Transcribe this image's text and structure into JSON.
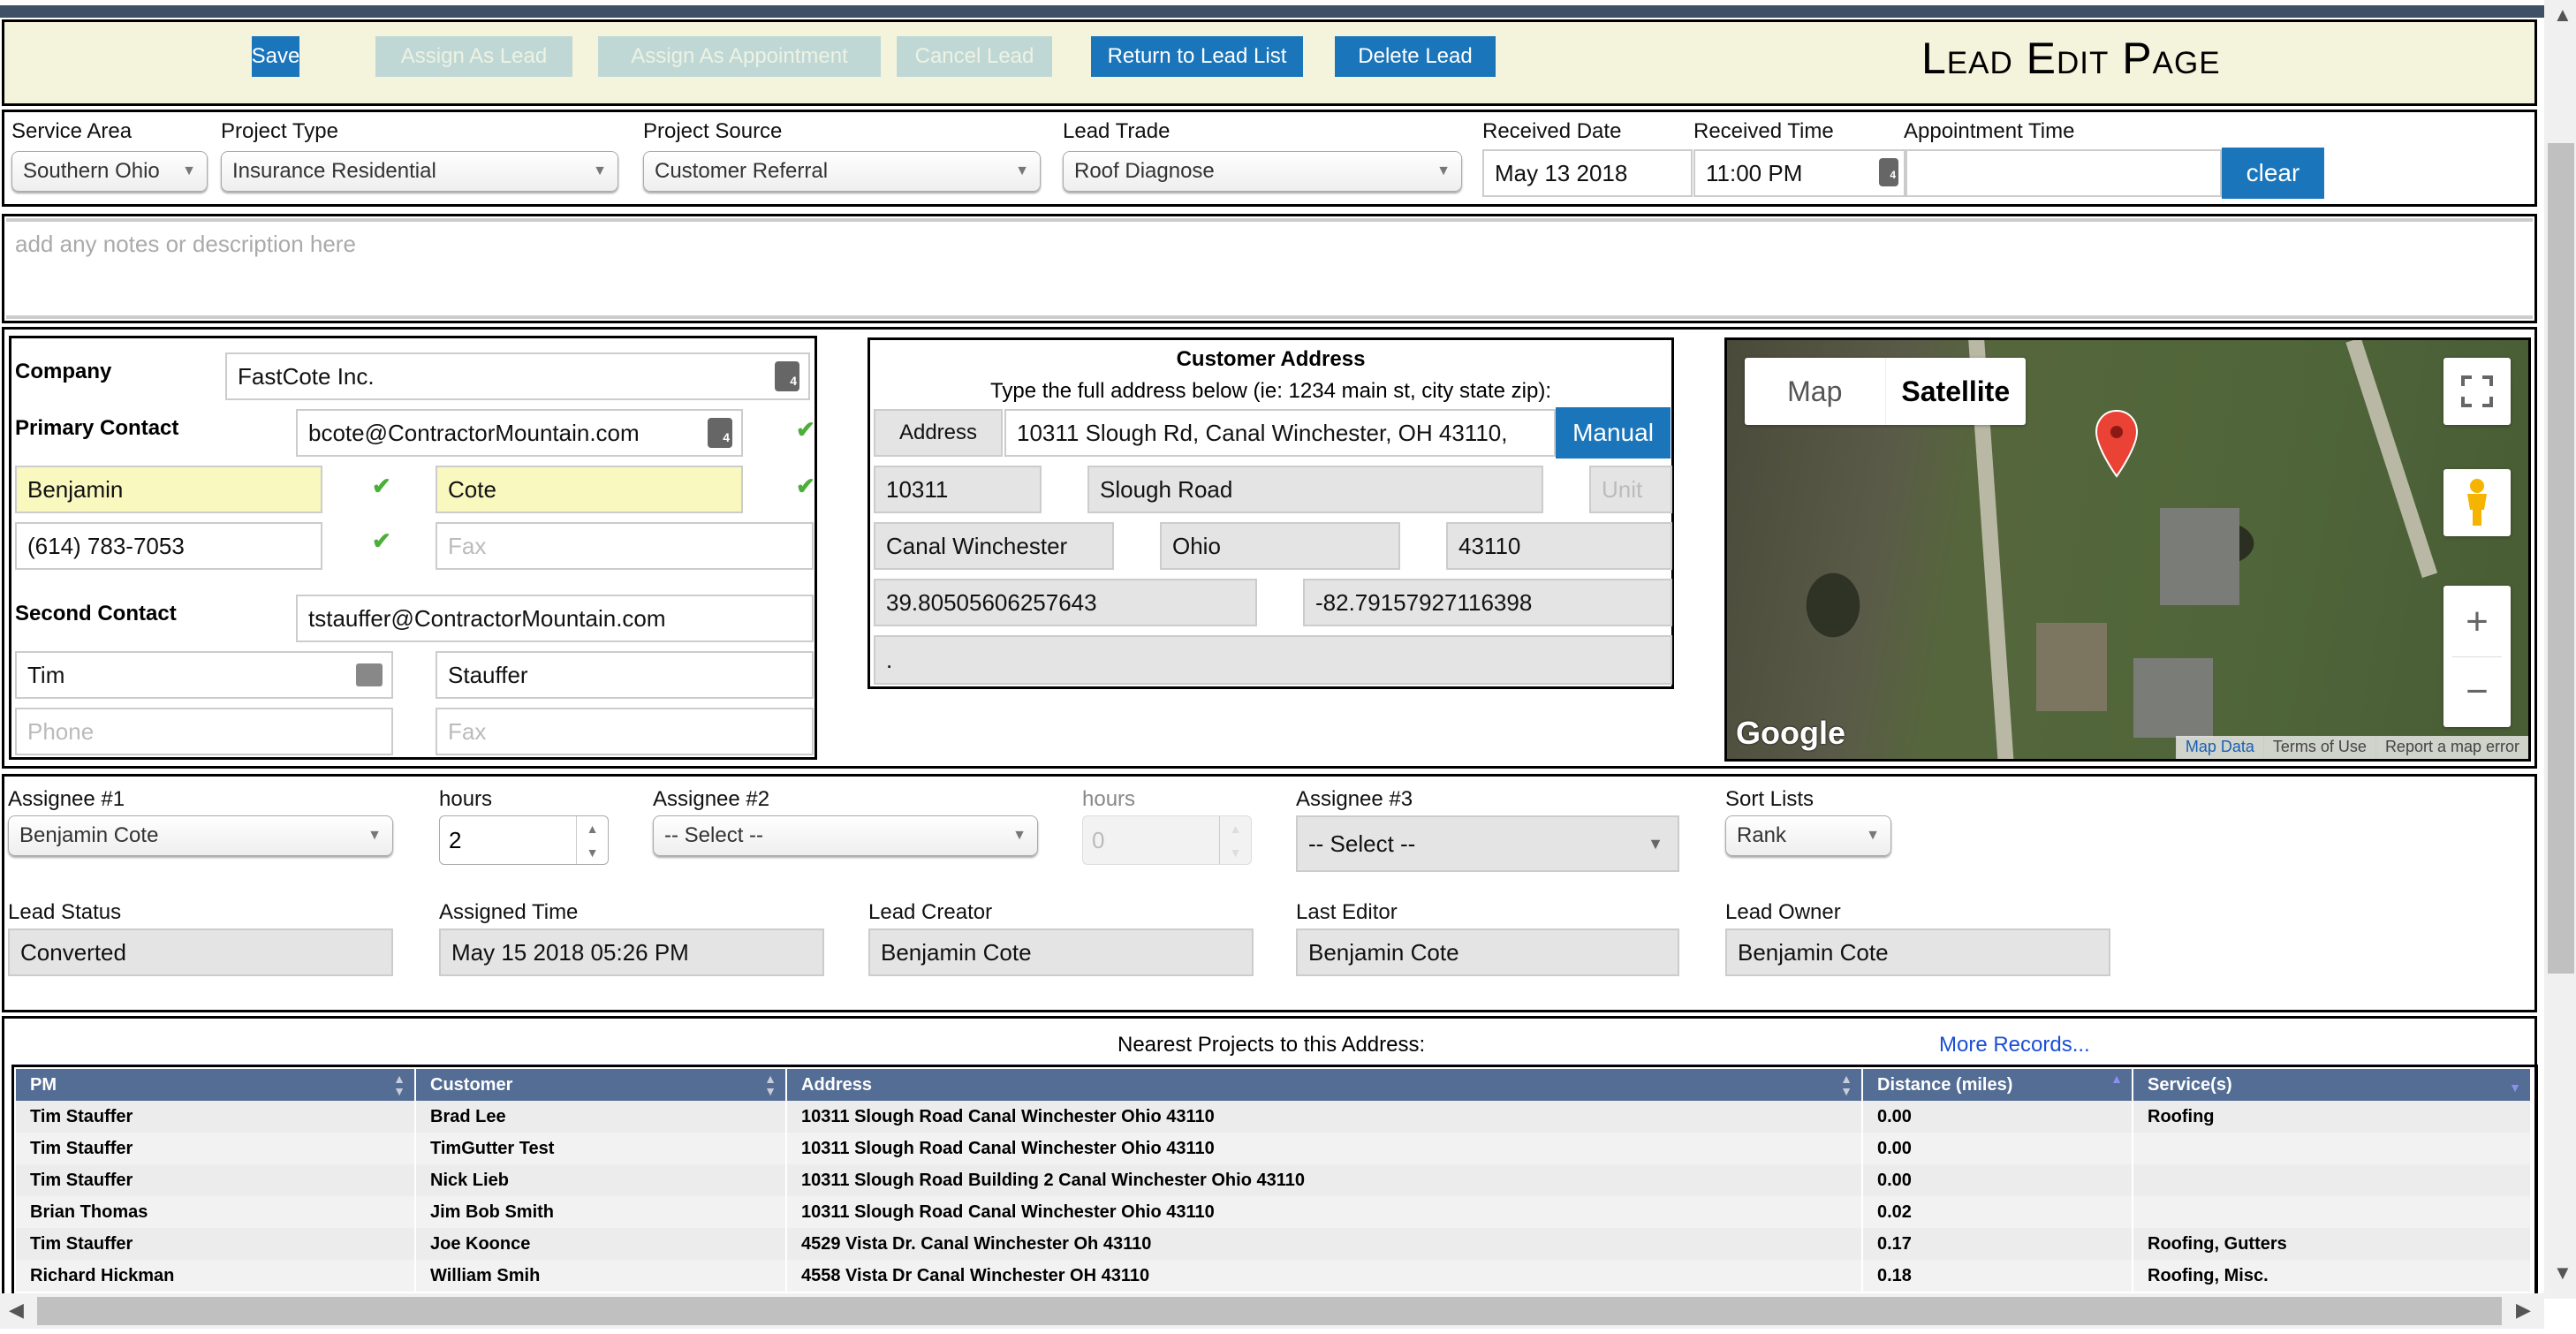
{
  "header": {
    "title": "Lead Edit Page",
    "buttons": {
      "save": "Save",
      "assign_lead": "Assign As Lead",
      "assign_appointment": "Assign As Appointment",
      "cancel_lead": "Cancel Lead",
      "return_list": "Return to Lead List",
      "delete_lead": "Delete Lead"
    }
  },
  "row1": {
    "service_area": {
      "label": "Service Area",
      "value": "Southern Ohio"
    },
    "project_type": {
      "label": "Project Type",
      "value": "Insurance Residential"
    },
    "project_source": {
      "label": "Project Source",
      "value": "Customer Referral"
    },
    "lead_trade": {
      "label": "Lead Trade",
      "value": "Roof Diagnose"
    },
    "received_date": {
      "label": "Received Date",
      "value": "May 13 2018"
    },
    "received_time": {
      "label": "Received Time",
      "value": "11:00 PM"
    },
    "appointment_time": {
      "label": "Appointment Time",
      "value": ""
    },
    "clear": "clear"
  },
  "notes": {
    "placeholder": "add any notes or description here"
  },
  "contact": {
    "company_label": "Company",
    "company": "FastCote Inc.",
    "primary_label": "Primary Contact",
    "primary_email": "bcote@ContractorMountain.com",
    "primary_first": "Benjamin",
    "primary_last": "Cote",
    "primary_phone": "(614) 783-7053",
    "primary_fax_placeholder": "Fax",
    "second_label": "Second Contact",
    "second_email": "tstauffer@ContractorMountain.com",
    "second_first": "Tim",
    "second_last": "Stauffer",
    "second_phone_placeholder": "Phone",
    "second_fax_placeholder": "Fax",
    "check": "✔",
    "badge": "4"
  },
  "address": {
    "title": "Customer Address",
    "subtitle": "Type the full address below (ie: 1234 main st, city state zip):",
    "address_label": "Address",
    "full": "10311 Slough Rd, Canal Winchester, OH 43110,",
    "manual": "Manual",
    "number": "10311",
    "street": "Slough Road",
    "unit_placeholder": "Unit",
    "city": "Canal Winchester",
    "state": "Ohio",
    "zip": "43110",
    "lat": "39.80505606257643",
    "lng": "-82.79157927116398",
    "extra": "."
  },
  "map": {
    "type_map": "Map",
    "type_satellite": "Satellite",
    "zoom_in": "+",
    "zoom_out": "−",
    "google": "Google",
    "footer": [
      "Map Data",
      "Terms of Use",
      "Report a map error"
    ]
  },
  "assign": {
    "assignee1": {
      "label": "Assignee #1",
      "value": "Benjamin Cote"
    },
    "hours1": {
      "label": "hours",
      "value": "2"
    },
    "assignee2": {
      "label": "Assignee #2",
      "value": "-- Select --"
    },
    "hours2": {
      "label": "hours",
      "value": "0"
    },
    "assignee3": {
      "label": "Assignee #3",
      "value": "-- Select --"
    },
    "sort": {
      "label": "Sort Lists",
      "value": "Rank"
    },
    "lead_status": {
      "label": "Lead Status",
      "value": "Converted"
    },
    "assigned_time": {
      "label": "Assigned Time",
      "value": "May 15 2018 05:26 PM"
    },
    "lead_creator": {
      "label": "Lead Creator",
      "value": "Benjamin Cote"
    },
    "last_editor": {
      "label": "Last Editor",
      "value": "Benjamin Cote"
    },
    "lead_owner": {
      "label": "Lead Owner",
      "value": "Benjamin Cote"
    }
  },
  "nearest": {
    "title": "Nearest Projects to this Address:",
    "more": "More Records...",
    "columns": [
      "PM",
      "Customer",
      "Address",
      "Distance (miles)",
      "Service(s)"
    ],
    "rows": [
      [
        "Tim Stauffer",
        "Brad Lee",
        "10311 Slough Road Canal Winchester Ohio 43110",
        "0.00",
        "Roofing"
      ],
      [
        "Tim Stauffer",
        "TimGutter Test",
        "10311 Slough Road Canal Winchester Ohio 43110",
        "0.00",
        ""
      ],
      [
        "Tim Stauffer",
        "Nick Lieb",
        "10311 Slough Road Building 2 Canal Winchester Ohio 43110",
        "0.00",
        ""
      ],
      [
        "Brian Thomas",
        "Jim Bob Smith",
        "10311 Slough Road Canal Winchester Ohio 43110",
        "0.02",
        ""
      ],
      [
        "Tim Stauffer",
        "Joe Koonce",
        "4529 Vista Dr. Canal Winchester Oh 43110",
        "0.17",
        "Roofing, Gutters"
      ],
      [
        "Richard Hickman",
        "William Smih",
        "4558 Vista Dr Canal Winchester OH 43110",
        "0.18",
        "Roofing, Misc."
      ]
    ]
  }
}
